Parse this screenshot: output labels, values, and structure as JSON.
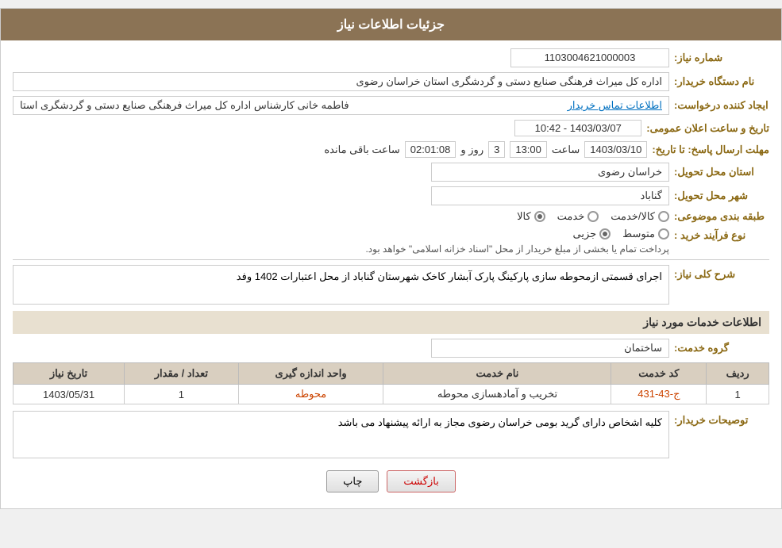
{
  "header": {
    "title": "جزئیات اطلاعات نیاز"
  },
  "fields": {
    "shomara_niaz_label": "شماره نیاز:",
    "shomara_niaz_value": "1103004621000003",
    "daststgah_label": "نام دستگاه خریدار:",
    "daststgah_value": "اداره کل میراث فرهنگی  صنایع دستی و گردشگری استان خراسان رضوی",
    "created_by_label": "ایجاد کننده درخواست:",
    "created_by_value": "فاطمه خانی کارشناس اداره کل میراث فرهنگی  صنایع دستی و گردشگری استا",
    "contact_link": "اطلاعات تماس خریدار",
    "date_label": "تاریخ و ساعت اعلان عمومی:",
    "date_value": "1403/03/07 - 10:42",
    "mohlat_label": "مهلت ارسال پاسخ: تا تاریخ:",
    "mohlat_date": "1403/03/10",
    "mohlat_saat_label": "ساعت",
    "mohlat_saat_value": "13:00",
    "mohlat_rooz_label": "روز و",
    "mohlat_rooz_value": "3",
    "mohlat_countdown": "02:01:08",
    "mohlat_remaining": "ساعت باقی مانده",
    "ostan_label": "استان محل تحویل:",
    "ostan_value": "خراسان رضوی",
    "shahr_label": "شهر محل تحویل:",
    "shahr_value": "گناباد",
    "tabaqe_label": "طبقه بندی موضوعی:",
    "tabaqe_options": [
      "کالا",
      "خدمت",
      "کالا/خدمت"
    ],
    "tabaqe_selected": "کالا",
    "farایند_label": "نوع فرآیند خرید :",
    "farayand_options": [
      "جزیی",
      "متوسط"
    ],
    "farayand_desc": "پرداخت تمام یا بخشی از مبلغ خریدار از محل \"اسناد خزانه اسلامی\" خواهد بود.",
    "sharh_label": "شرح کلی نیاز:",
    "sharh_value": "اجرای قسمتی ازمحوطه سازی پارکینگ پارک آبشار کاخک شهرستان گناباد از محل اعتبارات 1402 وفد",
    "services_title": "اطلاعات خدمات مورد نیاز",
    "group_label": "گروه خدمت:",
    "group_value": "ساختمان",
    "table": {
      "headers": [
        "ردیف",
        "کد خدمت",
        "نام خدمت",
        "واحد اندازه گیری",
        "تعداد / مقدار",
        "تاریخ نیاز"
      ],
      "rows": [
        {
          "radif": "1",
          "kod": "ج-43-431",
          "name": "تخریب و آمادهسازی محوطه",
          "unit": "محوطه",
          "count": "1",
          "date": "1403/05/31"
        }
      ]
    },
    "toseiat_label": "توصیحات خریدار:",
    "toseiat_value": "کلیه اشخاص دارای گرید بومی خراسان رضوی مجاز به ارائه پیشنهاد می باشد",
    "btn_print": "چاپ",
    "btn_back": "بازگشت"
  }
}
